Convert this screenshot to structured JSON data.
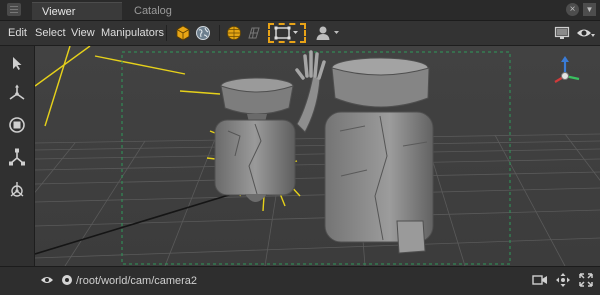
{
  "tabs": [
    {
      "label": "Viewer",
      "active": true
    },
    {
      "label": "Catalog",
      "active": false
    }
  ],
  "tab_controls": {
    "close_glyph": "×",
    "menu_glyph": "▼"
  },
  "menu": [
    "Edit",
    "Select",
    "View",
    "Manipulators"
  ],
  "toolbar_icons": [
    "yellow-cube-icon",
    "globe-icon",
    "yellow-sphere-icon",
    "grid-icon",
    "camera-frame-icon",
    "user-icon",
    "monitor-icon",
    "eye-icon"
  ],
  "left_tools": [
    "select-arrow-icon",
    "translate-icon",
    "rotate-icon",
    "scale-icon",
    "transform-icon"
  ],
  "viewport": {
    "guide_color": "#2e9a5a",
    "light_color": "#e6d11a"
  },
  "status": {
    "path": "/root/world/cam/camera2"
  },
  "colors": {
    "accent": "#e8a317",
    "panel": "#333333"
  }
}
